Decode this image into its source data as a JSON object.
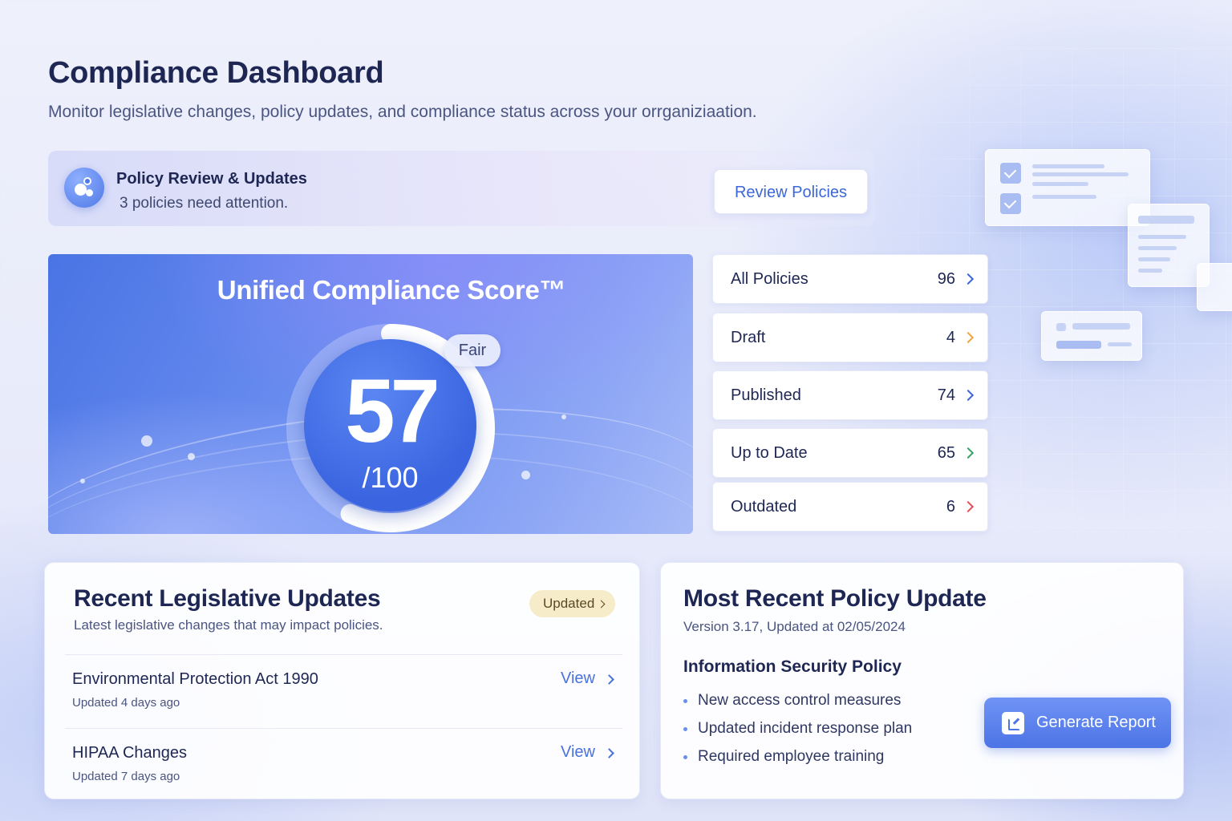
{
  "header": {
    "title": "Compliance Dashboard",
    "subtitle": "Monitor legislative changes, policy updates,  and compliance status across your orrganiziaation."
  },
  "banner": {
    "icon": "policy-icon",
    "title": "Policy Review & Updates",
    "text": "3 policies need attention.",
    "button_label": "Review Policies"
  },
  "score": {
    "title": "Unified Compliance Score™",
    "value": 57,
    "display_value": "57",
    "max_label": "/100",
    "rating": "Fair",
    "colors": {
      "card": "#5a80ea",
      "inner": "#3a64e0",
      "ring": "#ffffff"
    }
  },
  "stats": [
    {
      "label": "All Policies",
      "count": "96",
      "chevron_color": "#3d66d8"
    },
    {
      "label": "Draft",
      "count": "4",
      "chevron_color": "#f0a640"
    },
    {
      "label": "Published",
      "count": "74",
      "chevron_color": "#3d66d8"
    },
    {
      "label": "Up to Date",
      "count": "65",
      "chevron_color": "#3aa36a"
    },
    {
      "label": "Outdated",
      "count": "6",
      "chevron_color": "#e0505a"
    }
  ],
  "legislative": {
    "title": "Recent Legislative Updates",
    "subtitle": "Latest legislative changes that may impact policies.",
    "badge": "Updated",
    "items": [
      {
        "name": "Environmental Protection Act 1990",
        "time": "Updated 4 days ago",
        "action": "View"
      },
      {
        "name": "HIPAA Changes",
        "time": "Updated 7 days ago",
        "action": "View"
      }
    ]
  },
  "policy_update": {
    "title": "Most Recent Policy Update",
    "version": "Version 3.17, Updated at 02/05/2024",
    "policy_name": "Information Security Policy",
    "bullets": [
      "New access control measures",
      "Updated incident response plan",
      "Required employee training"
    ],
    "button_label": "Generate Report",
    "button_icon": "report-icon"
  }
}
